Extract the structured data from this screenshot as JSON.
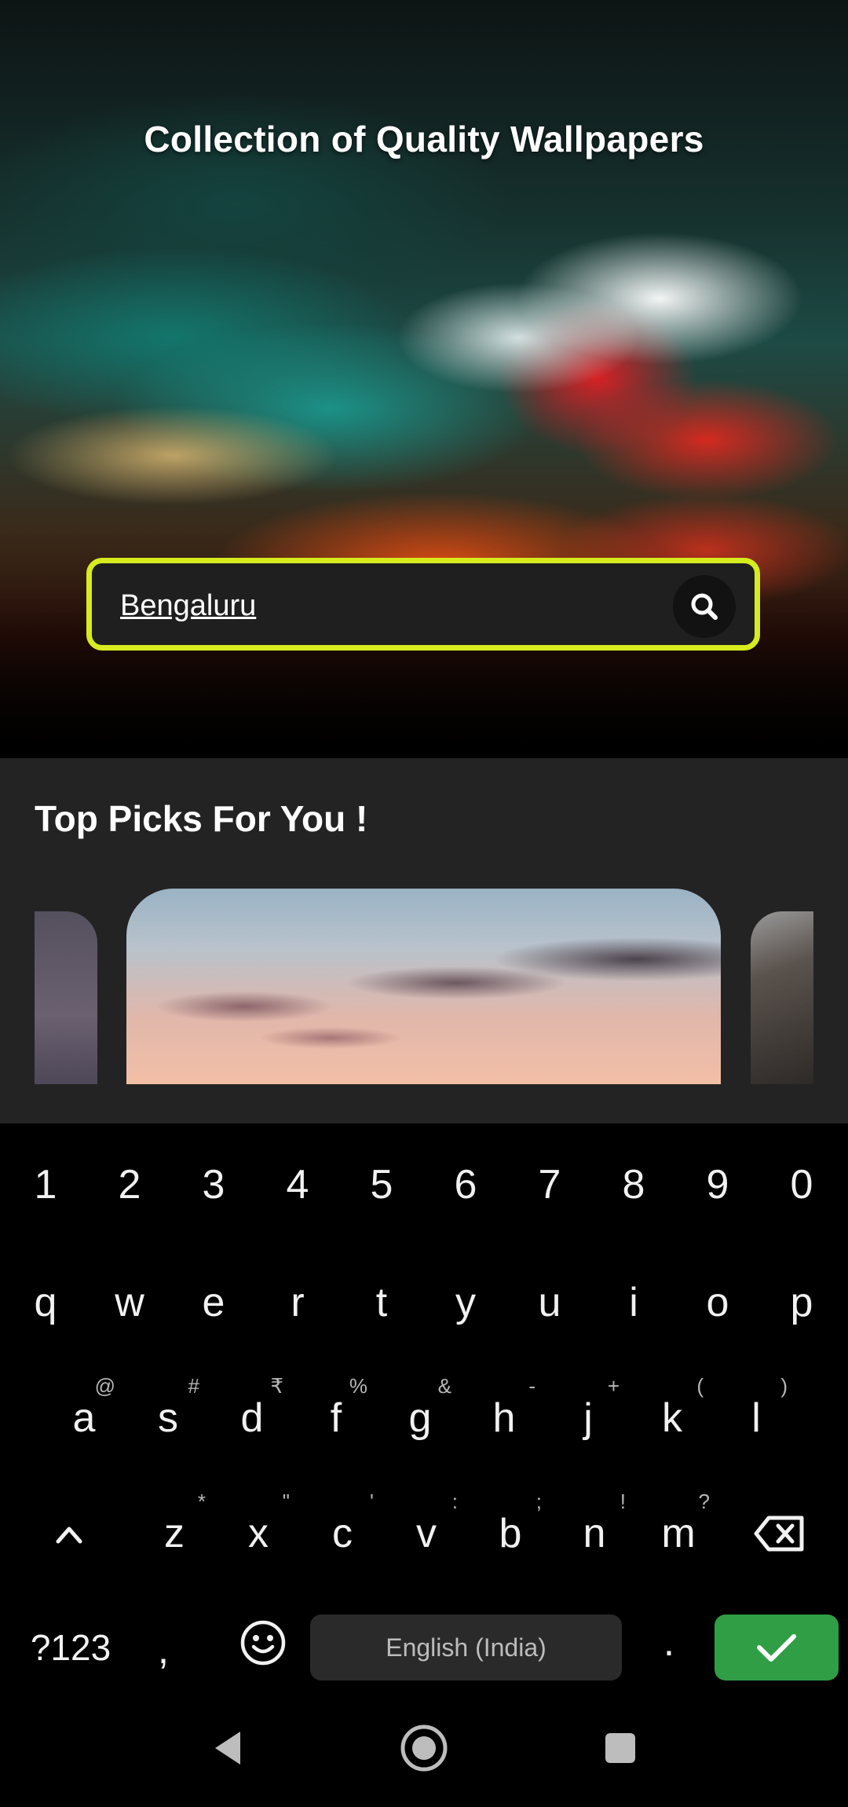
{
  "hero": {
    "title": "Collection of Quality Wallpapers",
    "search": {
      "value": "Bengaluru",
      "icon": "search-icon",
      "border_color": "#d6ec1e"
    }
  },
  "picks": {
    "title": "Top Picks For You !"
  },
  "keyboard": {
    "numbers": [
      "1",
      "2",
      "3",
      "4",
      "5",
      "6",
      "7",
      "8",
      "9",
      "0"
    ],
    "row1": [
      "q",
      "w",
      "e",
      "r",
      "t",
      "y",
      "u",
      "i",
      "o",
      "p"
    ],
    "row2": [
      {
        "key": "a",
        "hint": "@"
      },
      {
        "key": "s",
        "hint": "#"
      },
      {
        "key": "d",
        "hint": "₹"
      },
      {
        "key": "f",
        "hint": "%"
      },
      {
        "key": "g",
        "hint": "&"
      },
      {
        "key": "h",
        "hint": "-"
      },
      {
        "key": "j",
        "hint": "+"
      },
      {
        "key": "k",
        "hint": "("
      },
      {
        "key": "l",
        "hint": ")"
      }
    ],
    "row3": [
      {
        "key": "z",
        "hint": "*"
      },
      {
        "key": "x",
        "hint": "\""
      },
      {
        "key": "c",
        "hint": "'"
      },
      {
        "key": "v",
        "hint": ":"
      },
      {
        "key": "b",
        "hint": ";"
      },
      {
        "key": "n",
        "hint": "!"
      },
      {
        "key": "m",
        "hint": "?"
      }
    ],
    "symbols_key": "?123",
    "comma_key": ",",
    "period_key": ".",
    "space_label": "English (India)",
    "enter_color": "#2f9e44"
  }
}
